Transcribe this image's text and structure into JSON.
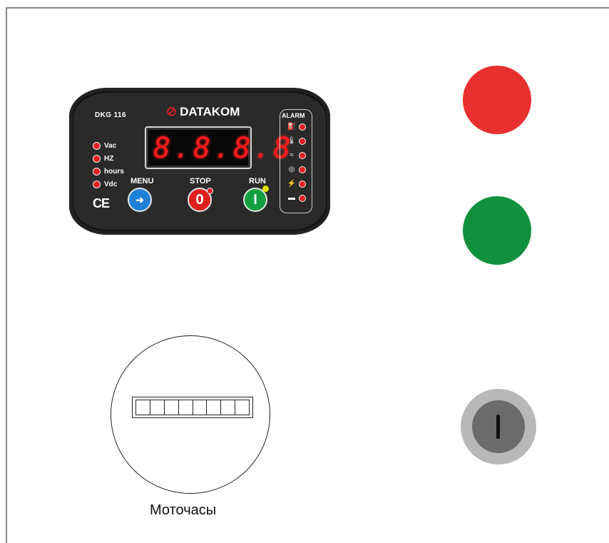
{
  "controller": {
    "model": "DKG 116",
    "brand": "DATAKOM",
    "display": "8.8.8.8",
    "leds": [
      "Vac",
      "HZ",
      "hours",
      "Vdc"
    ],
    "buttons": {
      "menu": "MENU",
      "stop": "STOP",
      "run": "RUN",
      "stop_glyph": "0",
      "run_glyph": "I"
    },
    "ce_mark": "CE",
    "alarm_title": "ALARM",
    "alarm_icons": [
      "oil-pressure-icon",
      "temperature-icon",
      "coolant-level-icon",
      "overspeed-icon",
      "charge-icon",
      "fuel-icon"
    ]
  },
  "lamps": {
    "red_color": "#e8302e",
    "green_color": "#11913d"
  },
  "switch": {
    "position_label": "I"
  },
  "hourmeter": {
    "label": "Моточасы",
    "cells": 8
  }
}
